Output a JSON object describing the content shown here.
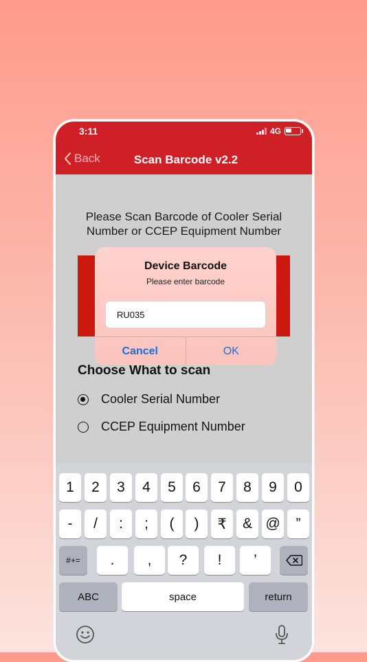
{
  "status_bar": {
    "time": "3:11",
    "network": "4G"
  },
  "nav": {
    "back_label": "Back",
    "title": "Scan Barcode v2.2"
  },
  "prompt": {
    "line1": "Please Scan Barcode of Cooler Serial",
    "line2": "Number or CCEP Equipment Number"
  },
  "choose": {
    "heading": "Choose What to scan",
    "options": [
      {
        "label": "Cooler Serial Number",
        "selected": true
      },
      {
        "label": "CCEP Equipment Number",
        "selected": false
      }
    ]
  },
  "dialog": {
    "title": "Device Barcode",
    "message": "Please enter barcode",
    "input_value": "RU035",
    "cancel_label": "Cancel",
    "ok_label": "OK"
  },
  "keyboard": {
    "row1": [
      "1",
      "2",
      "3",
      "4",
      "5",
      "6",
      "7",
      "8",
      "9",
      "0"
    ],
    "row2": [
      "-",
      "/",
      ":",
      ";",
      "(",
      ")",
      "₹",
      "&",
      "@",
      "”"
    ],
    "row3": [
      ".",
      ",",
      "?",
      "!",
      "’"
    ],
    "symbols_label": "#+=",
    "abc_label": "ABC",
    "space_label": "space",
    "return_label": "return"
  },
  "colors": {
    "header_red": "#cf2027",
    "scanner_red": "#cc1910",
    "link_blue": "#1a6fe0"
  }
}
